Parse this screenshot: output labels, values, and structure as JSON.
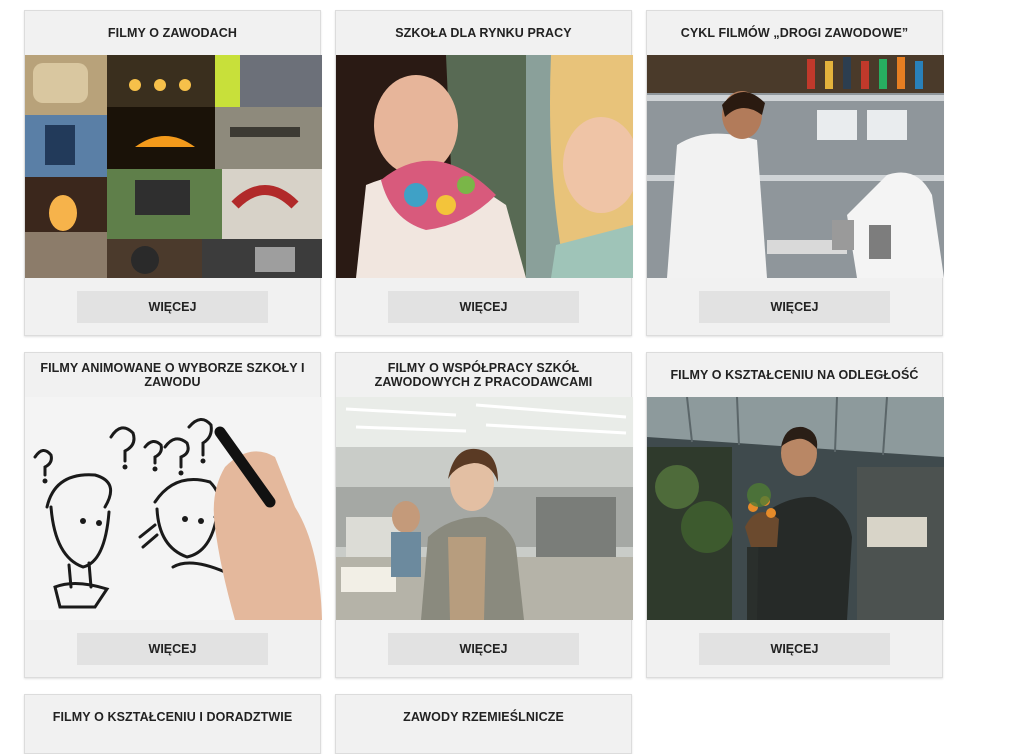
{
  "cards": [
    {
      "title": "FILMY O ZAWODACH",
      "button": "WIĘCEJ",
      "image": "collage-of-trades-photo"
    },
    {
      "title": "SZKOŁA DLA RYNKU PRACY",
      "button": "WIĘCEJ",
      "image": "two-young-women-smiling-photo"
    },
    {
      "title": "CYKL FILMÓW „DROGI ZAWODOWE”",
      "button": "WIĘCEJ",
      "image": "kitchen-chefs-photo"
    },
    {
      "title": "FILMY ANIMOWANE O WYBORZE SZKOŁY I ZAWODU",
      "button": "WIĘCEJ",
      "image": "hand-drawing-cartoon-characters-photo"
    },
    {
      "title": "FILMY O WSPÓŁPRACY SZKÓŁ ZAWODOWYCH Z PRACODAWCAMI",
      "button": "WIĘCEJ",
      "image": "woman-in-factory-hall-photo"
    },
    {
      "title": "FILMY O KSZTAŁCENIU NA ODLEGŁOŚĆ",
      "button": "WIĘCEJ",
      "image": "man-in-greenhouse-photo"
    },
    {
      "title": "FILMY O KSZTAŁCENIU I DORADZTWIE"
    },
    {
      "title": "ZAWODY RZEMIEŚLNICZE"
    }
  ]
}
